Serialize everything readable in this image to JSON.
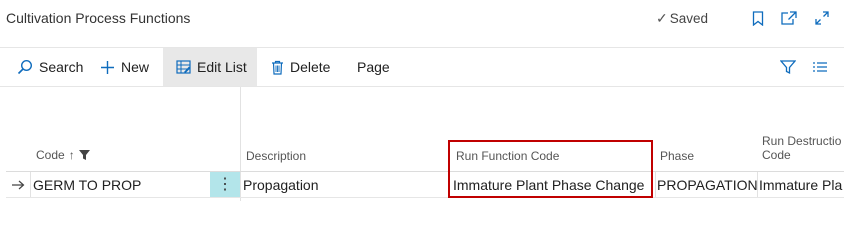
{
  "page": {
    "title": "Cultivation Process Functions",
    "saved_label": "Saved"
  },
  "toolbar": {
    "search_label": "Search",
    "new_label": "New",
    "edit_list_label": "Edit List",
    "delete_label": "Delete",
    "page_label": "Page"
  },
  "columns": {
    "code": "Code",
    "description": "Description",
    "run_function_code": "Run Function Code",
    "phase": "Phase",
    "run_destruction_code_line1": "Run Destructio",
    "run_destruction_code_line2": "Code"
  },
  "rows": [
    {
      "code": "GERM TO PROP",
      "description": "Propagation",
      "run_function_code": "Immature Plant Phase Change",
      "phase": "PROPAGATION",
      "run_destruction_code": "Immature Pla"
    }
  ],
  "colors": {
    "accent": "#0f6cbd",
    "highlight_box": "#c00000",
    "row_menu_bg": "#b3e5ea",
    "active_button_bg": "#e8e8e8"
  }
}
